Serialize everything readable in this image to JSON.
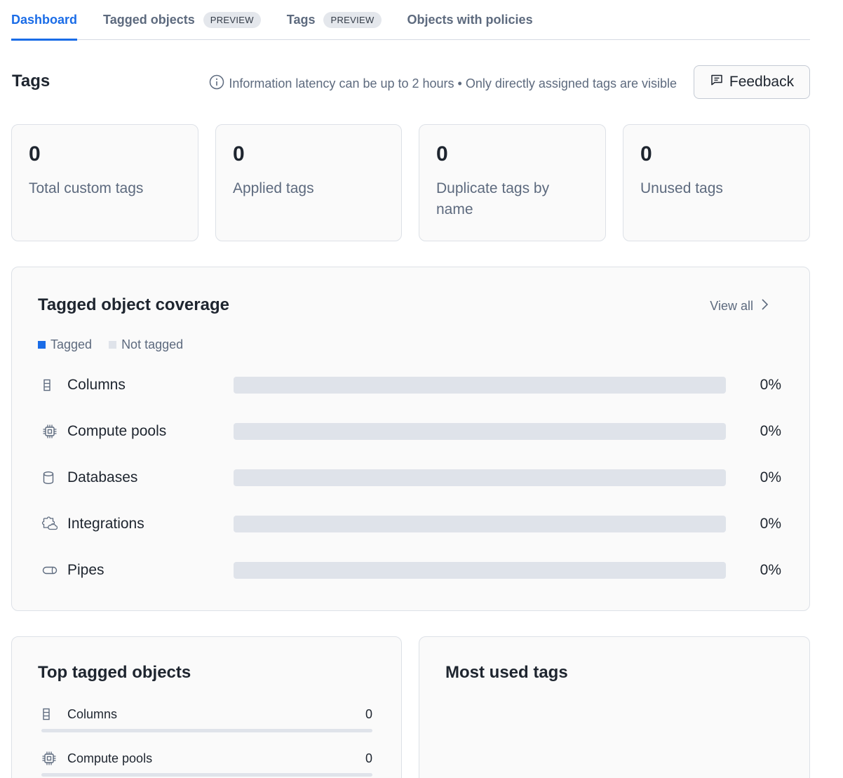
{
  "tabs": [
    {
      "label": "Dashboard",
      "active": true,
      "badge": ""
    },
    {
      "label": "Tagged objects",
      "active": false,
      "badge": "PREVIEW"
    },
    {
      "label": "Tags",
      "active": false,
      "badge": "PREVIEW"
    },
    {
      "label": "Objects with policies",
      "active": false,
      "badge": ""
    }
  ],
  "header": {
    "title": "Tags",
    "info_text": "Information latency can be up to 2 hours • Only directly assigned tags are visible",
    "info_icon": "info-circle-icon",
    "feedback_label": "Feedback",
    "feedback_icon": "message-square-icon"
  },
  "stats": [
    {
      "value": "0",
      "label": "Total custom tags"
    },
    {
      "value": "0",
      "label": "Applied tags"
    },
    {
      "value": "0",
      "label": "Duplicate tags by name"
    },
    {
      "value": "0",
      "label": "Unused tags"
    }
  ],
  "coverage": {
    "title": "Tagged object coverage",
    "view_all_label": "View all",
    "legend": [
      {
        "label": "Tagged",
        "color": "#1a6ce7"
      },
      {
        "label": "Not tagged",
        "color": "#dfe3ea"
      }
    ],
    "rows": [
      {
        "name": "Columns",
        "icon": "column-icon",
        "percent_label": "0%",
        "percent": 0
      },
      {
        "name": "Compute pools",
        "icon": "chip-icon",
        "percent_label": "0%",
        "percent": 0
      },
      {
        "name": "Databases",
        "icon": "database-icon",
        "percent_label": "0%",
        "percent": 0
      },
      {
        "name": "Integrations",
        "icon": "puzzle-icon",
        "percent_label": "0%",
        "percent": 0
      },
      {
        "name": "Pipes",
        "icon": "pipe-icon",
        "percent_label": "0%",
        "percent": 0
      }
    ]
  },
  "top_tagged": {
    "title": "Top tagged objects",
    "rows": [
      {
        "name": "Columns",
        "icon": "column-icon",
        "value": "0",
        "fraction": 0
      },
      {
        "name": "Compute pools",
        "icon": "chip-icon",
        "value": "0",
        "fraction": 0
      }
    ]
  },
  "most_used": {
    "title": "Most used tags"
  },
  "colors": {
    "accent": "#1a6ce7",
    "track": "#dfe3ea",
    "muted_text": "#5d6a7e"
  }
}
